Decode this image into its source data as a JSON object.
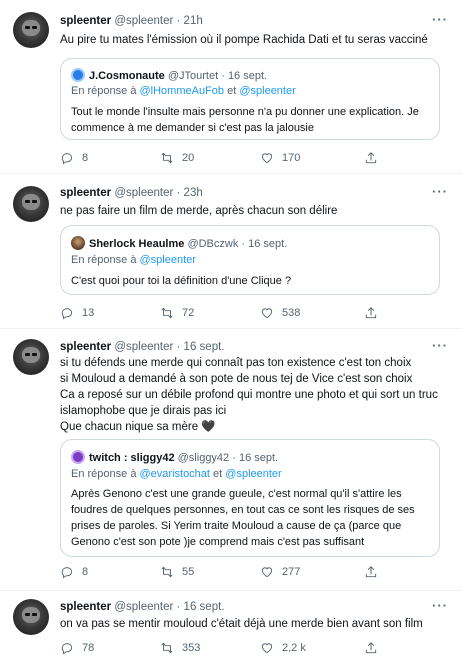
{
  "tweets": [
    {
      "name": "spleenter",
      "handle": "@spleenter",
      "time": "· 21h",
      "text": [
        "Au pire tu mates l'émission où il pompe Rachida Dati et tu seras vacciné"
      ],
      "quote": {
        "name": "J.Cosmonaute",
        "handle": "@JTourtet",
        "time": "· 16 sept.",
        "reply_prefix": "En réponse à",
        "reply_to_1": "@lHommeAuFob",
        "reply_and": "et",
        "reply_to_2": "@spleenter",
        "text": [
          "Tout le monde l'insulte mais personne n'a pu donner une explication. Je",
          "commence à me demander si c'est pas la jalousie"
        ]
      },
      "replies": "8",
      "retweets": "20",
      "likes": "170"
    },
    {
      "name": "spleenter",
      "handle": "@spleenter",
      "time": "· 23h",
      "text": [
        "ne pas faire un film de merde, après chacun son délire"
      ],
      "quote": {
        "name": "Sherlock Heaulme",
        "handle": "@DBczwk",
        "time": "· 16 sept.",
        "reply_prefix": "En réponse à",
        "reply_to_1": "@spleenter",
        "reply_and": "",
        "reply_to_2": "",
        "text": [
          "C'est quoi pour toi la définition d'une Clique ?"
        ]
      },
      "replies": "13",
      "retweets": "72",
      "likes": "538"
    },
    {
      "name": "spleenter",
      "handle": "@spleenter",
      "time": "· 16 sept.",
      "text": [
        "si tu défends une merde qui connaît pas ton existence c'est ton choix",
        "si Mouloud a demandé à son pote de nous tej de Vice c'est son choix",
        "Ca a reposé sur un débile profond qui montre une photo et qui sort un truc",
        "islamophobe que je dirais pas ici",
        "Que chacun nique sa mère 🖤"
      ],
      "quote": {
        "name": "twitch : sliggy42",
        "handle": "@sliggy42",
        "time": "· 16 sept.",
        "reply_prefix": "En réponse à",
        "reply_to_1": "@evaristochat",
        "reply_and": "et",
        "reply_to_2": "@spleenter",
        "text": [
          "Après Genono c'est une grande gueule, c'est normal qu'il s'attire les",
          "foudres de quelques personnes, en tout cas ce sont les risques de ses",
          "prises de paroles. Si Yerim traite Mouloud a cause de ça (parce que",
          "Genono c'est son pote )je comprend mais c'est pas suffisant"
        ]
      },
      "replies": "8",
      "retweets": "55",
      "likes": "277"
    },
    {
      "name": "spleenter",
      "handle": "@spleenter",
      "time": "· 16 sept.",
      "text": [
        "on va pas se mentir mouloud c'était déjà une merde bien avant son film"
      ],
      "quote": null,
      "replies": "78",
      "retweets": "353",
      "likes": "2,2 k"
    }
  ],
  "icons": {
    "more": "more-dots-icon",
    "reply": "reply-bubble-icon",
    "retweet": "retweet-icon",
    "like": "heart-icon",
    "share": "share-icon"
  },
  "colors": {
    "link": "#1d9bf0",
    "muted": "#536471",
    "text": "#0f1419",
    "border": "#cfd9de"
  }
}
